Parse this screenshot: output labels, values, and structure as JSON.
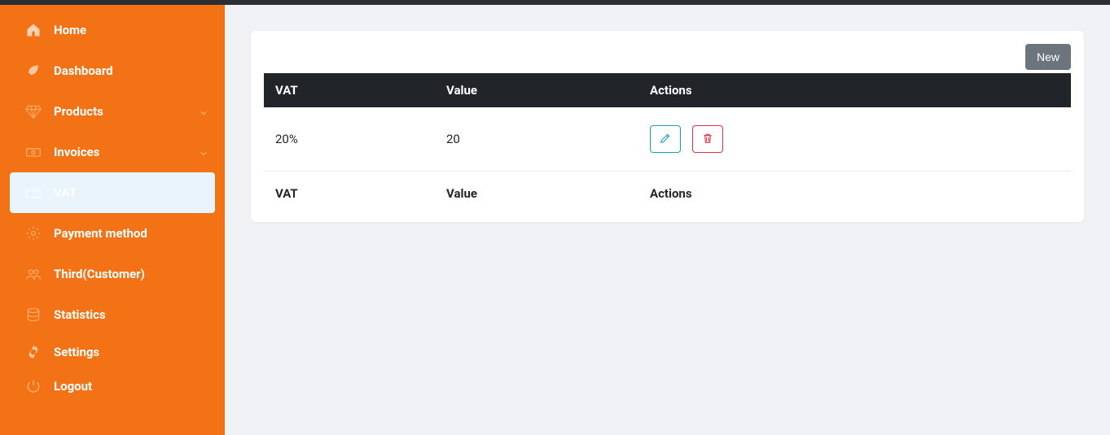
{
  "sidebar": {
    "items": [
      {
        "label": "Home",
        "icon": "home-icon"
      },
      {
        "label": "Dashboard",
        "icon": "rocket-icon"
      },
      {
        "label": "Products",
        "icon": "diamond-icon",
        "expandable": true
      },
      {
        "label": "Invoices",
        "icon": "cash-icon",
        "expandable": true
      },
      {
        "label": "VAT",
        "icon": "card-icon",
        "active": true
      },
      {
        "label": "Payment method",
        "icon": "gear-outline-icon"
      },
      {
        "label": "Third(Customer)",
        "icon": "users-icon"
      },
      {
        "label": "Statistics",
        "icon": "database-icon"
      },
      {
        "label": "Settings",
        "icon": "cog-icon"
      },
      {
        "label": "Logout",
        "icon": "power-icon"
      }
    ]
  },
  "buttons": {
    "new_label": "New"
  },
  "table": {
    "headers": {
      "vat": "VAT",
      "value": "Value",
      "actions": "Actions"
    },
    "footers": {
      "vat": "VAT",
      "value": "Value",
      "actions": "Actions"
    },
    "rows": [
      {
        "vat": "20%",
        "value": "20"
      }
    ],
    "action_icons": {
      "edit": "pencil-icon",
      "delete": "trash-icon"
    }
  }
}
